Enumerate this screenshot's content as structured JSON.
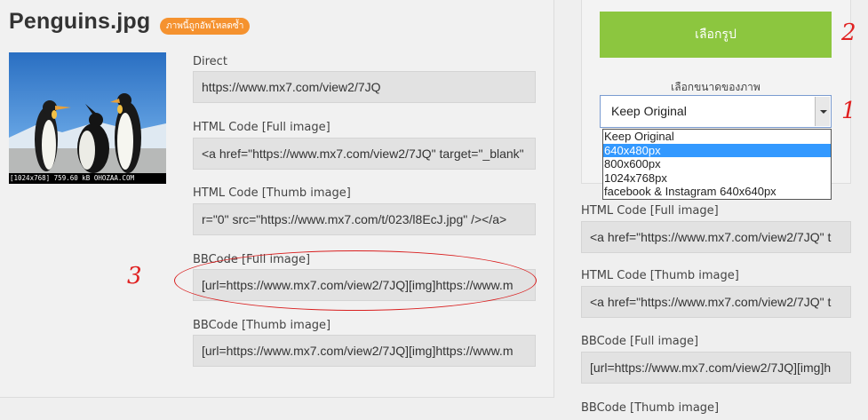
{
  "header": {
    "title": "Penguins.jpg",
    "badge": "ภาพนี้ถูกอัพโหลดซ้ำ"
  },
  "thumbnail": {
    "caption": "[1024x768] 759.60 kB OHOZAA.COM"
  },
  "left_fields": [
    {
      "label": "Direct",
      "value": "https://www.mx7.com/view2/7JQ"
    },
    {
      "label": "HTML Code [Full image]",
      "value": "<a href=\"https://www.mx7.com/view2/7JQ\" target=\"_blank\""
    },
    {
      "label": "HTML Code [Thumb image]",
      "value": "r=\"0\" src=\"https://www.mx7.com/t/023/l8EcJ.jpg\" /></a>"
    },
    {
      "label": "BBCode [Full image]",
      "value": "[url=https://www.mx7.com/view2/7JQ][img]https://www.m"
    },
    {
      "label": "BBCode [Thumb image]",
      "value": "[url=https://www.mx7.com/view2/7JQ][img]https://www.m"
    }
  ],
  "right_panel": {
    "button_label": "เลือกรูป",
    "size_label": "เลือกขนาดของภาพ",
    "selected_value": "Keep Original",
    "options": [
      "Keep Original",
      "640x480px",
      "800x600px",
      "1024x768px",
      "facebook & Instagram 640x640px"
    ],
    "highlighted_option": "640x480px"
  },
  "right_fields": [
    {
      "label": "HTML Code [Full image]",
      "value": "<a href=\"https://www.mx7.com/view2/7JQ\" t"
    },
    {
      "label": "HTML Code [Thumb image]",
      "value": "<a href=\"https://www.mx7.com/view2/7JQ\" t"
    },
    {
      "label": "BBCode [Full image]",
      "value": "[url=https://www.mx7.com/view2/7JQ][img]h"
    },
    {
      "label": "BBCode [Thumb image]"
    }
  ],
  "annotations": {
    "one": "1",
    "two": "2",
    "three": "3"
  },
  "colors": {
    "accent_green": "#8cc63f",
    "badge_orange": "#f5922f",
    "highlight_blue": "#3399ff",
    "annotation_red": "#e02020"
  }
}
